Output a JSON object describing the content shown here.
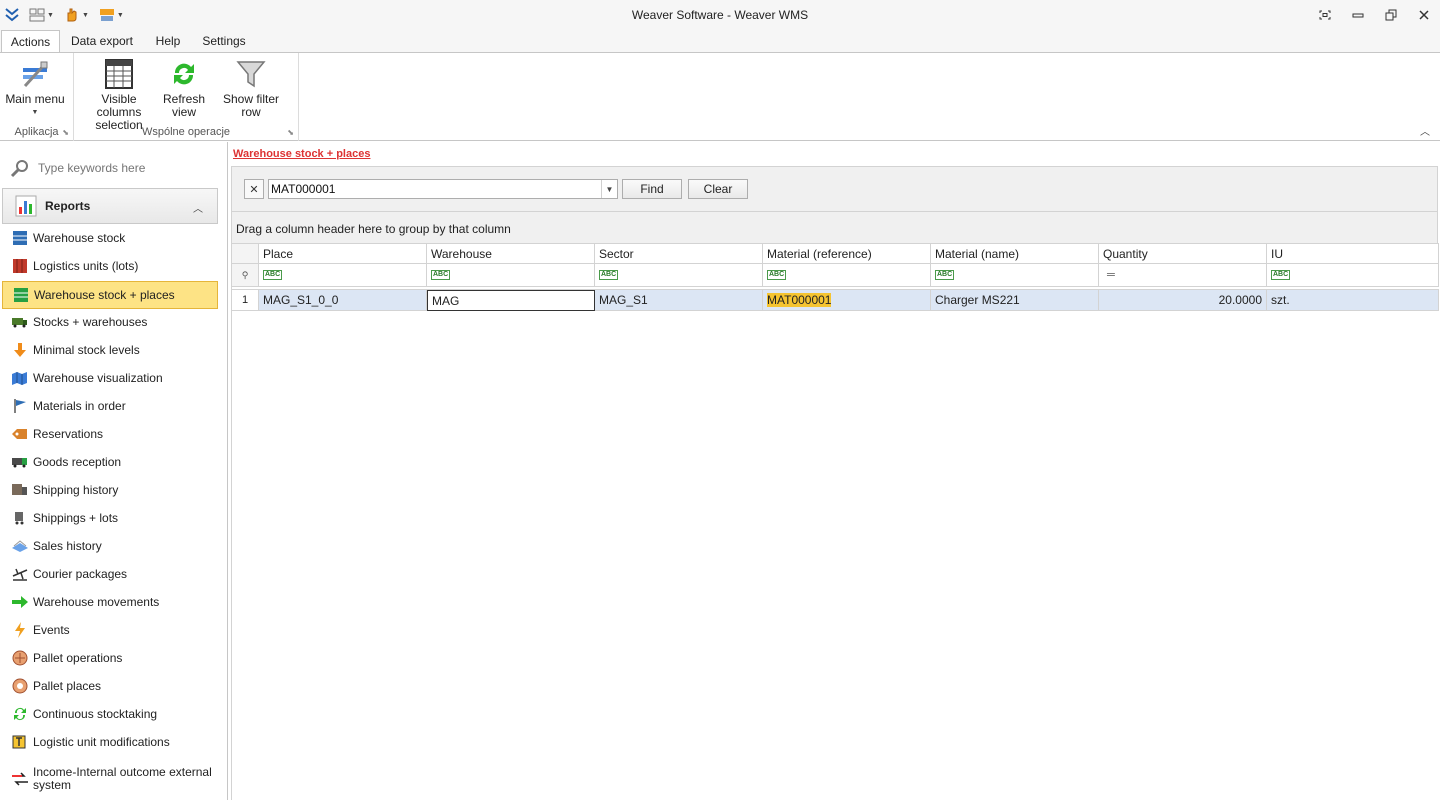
{
  "window": {
    "title": "Weaver Software - Weaver WMS"
  },
  "ribbon_tabs": [
    "Actions",
    "Data export",
    "Help",
    "Settings"
  ],
  "ribbon": {
    "groups": [
      {
        "label": "Aplikacja",
        "buttons": [
          {
            "label": "Main menu",
            "icon": "main-menu-icon"
          }
        ]
      },
      {
        "label": "Wspólne operacje",
        "buttons": [
          {
            "label": "Visible columns selection",
            "line1": "Visible columns",
            "line2": "selection",
            "icon": "columns-table-icon"
          },
          {
            "label": "Refresh view",
            "line1": "Refresh",
            "line2": "view",
            "icon": "refresh-icon"
          },
          {
            "label": "Show filter row",
            "line1": "Show filter row",
            "line2": "",
            "icon": "funnel-icon"
          }
        ]
      }
    ]
  },
  "sidebar": {
    "search_placeholder": "Type keywords here",
    "group": "Reports",
    "items": [
      {
        "label": "Warehouse stock",
        "icon": "blue-shelf-icon"
      },
      {
        "label": "Logistics units (lots)",
        "icon": "red-container-icon"
      },
      {
        "label": "Warehouse stock + places",
        "icon": "green-shelf-icon",
        "active": true
      },
      {
        "label": "Stocks + warehouses",
        "icon": "truck-icon"
      },
      {
        "label": "Minimal stock levels",
        "icon": "down-arrow-icon"
      },
      {
        "label": "Warehouse visualization",
        "icon": "map-icon"
      },
      {
        "label": "Materials in order",
        "icon": "flag-icon"
      },
      {
        "label": "Reservations",
        "icon": "tag-icon"
      },
      {
        "label": "Goods reception",
        "icon": "delivery-truck-icon"
      },
      {
        "label": "Shipping history",
        "icon": "shipping-icon"
      },
      {
        "label": "Shippings + lots",
        "icon": "cart-icon"
      },
      {
        "label": "Sales history",
        "icon": "sales-icon"
      },
      {
        "label": "Courier packages",
        "icon": "plane-icon"
      },
      {
        "label": "Warehouse movements",
        "icon": "green-arrow-icon"
      },
      {
        "label": "Events",
        "icon": "lightning-icon"
      },
      {
        "label": "Pallet operations",
        "icon": "pallet-icon"
      },
      {
        "label": "Pallet places",
        "icon": "pallet-place-icon"
      },
      {
        "label": "Continuous stocktaking",
        "icon": "cycle-icon"
      },
      {
        "label": "Logistic unit modifications",
        "icon": "edit-unit-icon"
      },
      {
        "label": "Income-Internal outcome external system",
        "line1": "Income-Internal outcome external",
        "line2": "system",
        "icon": "exchange-arrows-icon"
      }
    ]
  },
  "main": {
    "title": "Warehouse stock + places",
    "find": {
      "value": "MAT000001",
      "find_label": "Find",
      "clear_label": "Clear"
    },
    "group_panel_text": "Drag a column header here to group by that column",
    "columns": [
      "Place",
      "Warehouse",
      "Sector",
      "Material (reference)",
      "Material (name)",
      "Quantity",
      "IU"
    ],
    "rows": [
      {
        "num": "1",
        "cells": [
          "MAG_S1_0_0",
          "MAG",
          "MAG_S1",
          "MAT000001",
          "Charger MS221",
          "20.0000",
          "szt."
        ]
      }
    ]
  },
  "colors": {
    "active_item": "#fde385",
    "highlight": "#f5c431",
    "selected_row": "#dce6f4",
    "title_link": "#dd3333"
  }
}
